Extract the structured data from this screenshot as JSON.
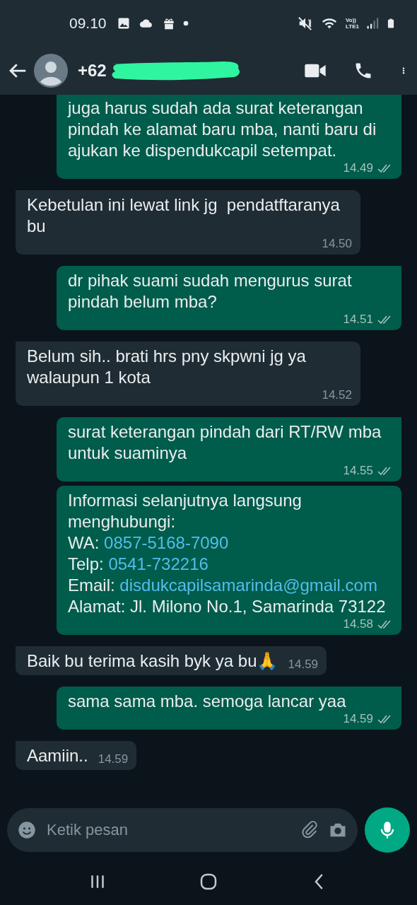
{
  "status_bar": {
    "time": "09.10",
    "network_top": "Vo))",
    "network_bottom": "LTE1"
  },
  "header": {
    "title": "+62",
    "redacted": true
  },
  "messages": [
    {
      "kind": "outgoing",
      "continued": true,
      "lines": [
        {
          "text": "juga harus sudah ada surat keterangan pindah ke alamat baru mba, nanti baru di ajukan ke dispendukcapil setempat."
        }
      ],
      "time": "14.49",
      "read": false
    },
    {
      "kind": "incoming",
      "lines": [
        {
          "text": "Kebetulan ini lewat link jg  pendatftaranya bu"
        }
      ],
      "time": "14.50"
    },
    {
      "kind": "outgoing",
      "lines": [
        {
          "text": "dr pihak suami sudah mengurus surat pindah belum mba?"
        }
      ],
      "time": "14.51",
      "read": false
    },
    {
      "kind": "incoming",
      "lines": [
        {
          "text": "Belum sih.. brati hrs pny skpwni jg ya walaupun 1 kota"
        }
      ],
      "time": "14.52"
    },
    {
      "kind": "outgoing",
      "lines": [
        {
          "text": "surat keterangan pindah dari RT/RW mba untuk suaminya"
        }
      ],
      "time": "14.55",
      "read": false
    },
    {
      "kind": "outgoing",
      "continued": true,
      "lines": [
        {
          "text": "Informasi selanjutnya langsung menghubungi:"
        },
        {
          "text": "WA:",
          "link": "0857-5168-7090"
        },
        {
          "text": "Telp:",
          "link": "0541-732216"
        },
        {
          "text": "Email:",
          "link": "disdukcapilsamarinda@gmail.com"
        },
        {
          "text": "Alamat: Jl. Milono No.1, Samarinda 73122"
        }
      ],
      "time": "14.58",
      "read": false
    },
    {
      "kind": "incoming",
      "lines": [
        {
          "text": "Baik bu terima kasih byk ya bu🙏"
        }
      ],
      "time": "14.59"
    },
    {
      "kind": "outgoing",
      "lines": [
        {
          "text": "sama sama mba. semoga lancar yaa"
        }
      ],
      "time": "14.59",
      "read": false
    },
    {
      "kind": "incoming",
      "lines": [
        {
          "text": "Aamiin.."
        }
      ],
      "time": "14.59"
    }
  ],
  "composer": {
    "placeholder": "Ketik pesan"
  }
}
